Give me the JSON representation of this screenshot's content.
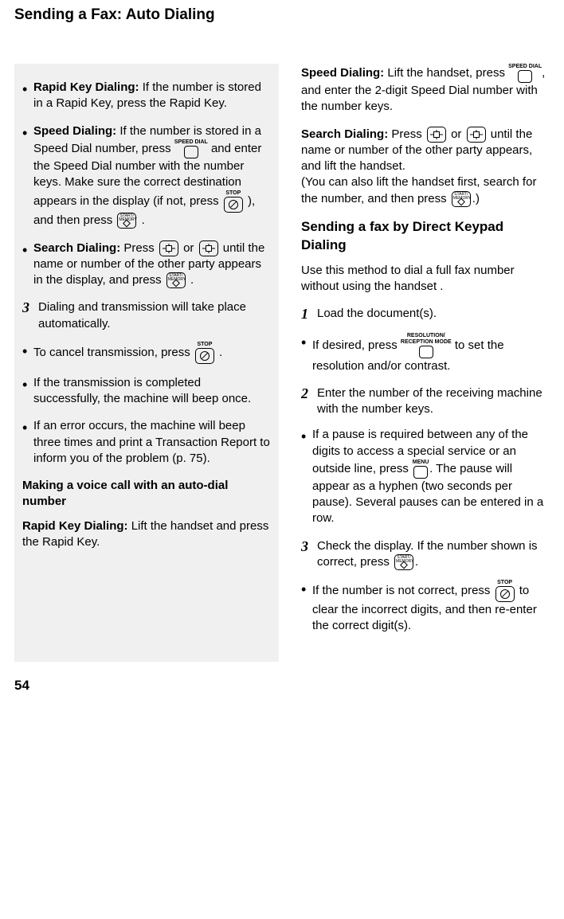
{
  "pageTitle": "Sending a Fax: Auto Dialing",
  "pageNumber": "54",
  "left": {
    "rapidKey": {
      "label": "Rapid Key Dialing:",
      "text": " If the number is stored in a Rapid Key, press the Rapid Key."
    },
    "speedDial": {
      "label": "Speed Dialing:",
      "text1": " If the number is stored in a Speed Dial number, press ",
      "keyLabel": "SPEED DIAL",
      "text2": " and enter the Speed Dial number with the number keys. Make sure the correct destination appears in the display (if not, press ",
      "stopLabel": "STOP",
      "text3": " ), and then press ",
      "text4": "."
    },
    "searchDial": {
      "label": "Search Dialing:",
      "text1": " Press ",
      "text2": " or ",
      "text3": " until the name or number of the other party appears in the display, and press ",
      "text4": "."
    },
    "step3": "Dialing and transmission will take place automatically.",
    "cancel": {
      "text1": "To cancel transmission, press ",
      "stopLabel": "STOP",
      "text2": " ."
    },
    "success": "If the transmission is completed successfully, the machine will beep once.",
    "error": "If an error occurs, the machine will beep three times and print a Transaction Report to inform you of the problem (p. 75).",
    "voiceHeading": "Making a voice call with an auto-dial number",
    "voiceRapid": {
      "label": "Rapid Key Dialing:",
      "text": " Lift the handset and press the Rapid Key."
    }
  },
  "right": {
    "speedDial": {
      "label": "Speed Dialing:",
      "text1": " Lift the handset, press ",
      "keyLabel": "SPEED DIAL",
      "text2": ", and enter the 2-digit Speed Dial number with the number keys."
    },
    "searchDial": {
      "label": "Search Dialing:",
      "text1": " Press ",
      "text2": " or ",
      "text3": " until the name or number of the other party appears, and lift the handset.",
      "text4": "(You can also lift the handset first, search for the number, and then press ",
      "text5": ".)"
    },
    "directHeading": "Sending a fax by Direct Keypad Dialing",
    "directIntro": "Use this method to dial a full fax number without using the handset .",
    "step1": "Load the document(s).",
    "resBullet": {
      "text1": "If desired, press ",
      "keyLabel": "RESOLUTION/\nRECEPTION MODE",
      "text2": " to set the resolution and/or contrast."
    },
    "step2": "Enter the number of the receiving machine with the number keys.",
    "pauseBullet": {
      "text1": "If a pause is required between any of the digits to access a special service or an outside line, press ",
      "keyLabel": "MENU",
      "text2": ". The pause will appear as a hyphen (two seconds per pause). Several pauses can be entered in a row."
    },
    "step3": {
      "text1": "Check the display. If the number shown is correct, press ",
      "text2": "."
    },
    "wrongBullet": {
      "text1": "If the number is not correct, press ",
      "stopLabel": "STOP",
      "text2": " to clear the incorrect digits, and then re-enter the correct digit(s)."
    }
  }
}
